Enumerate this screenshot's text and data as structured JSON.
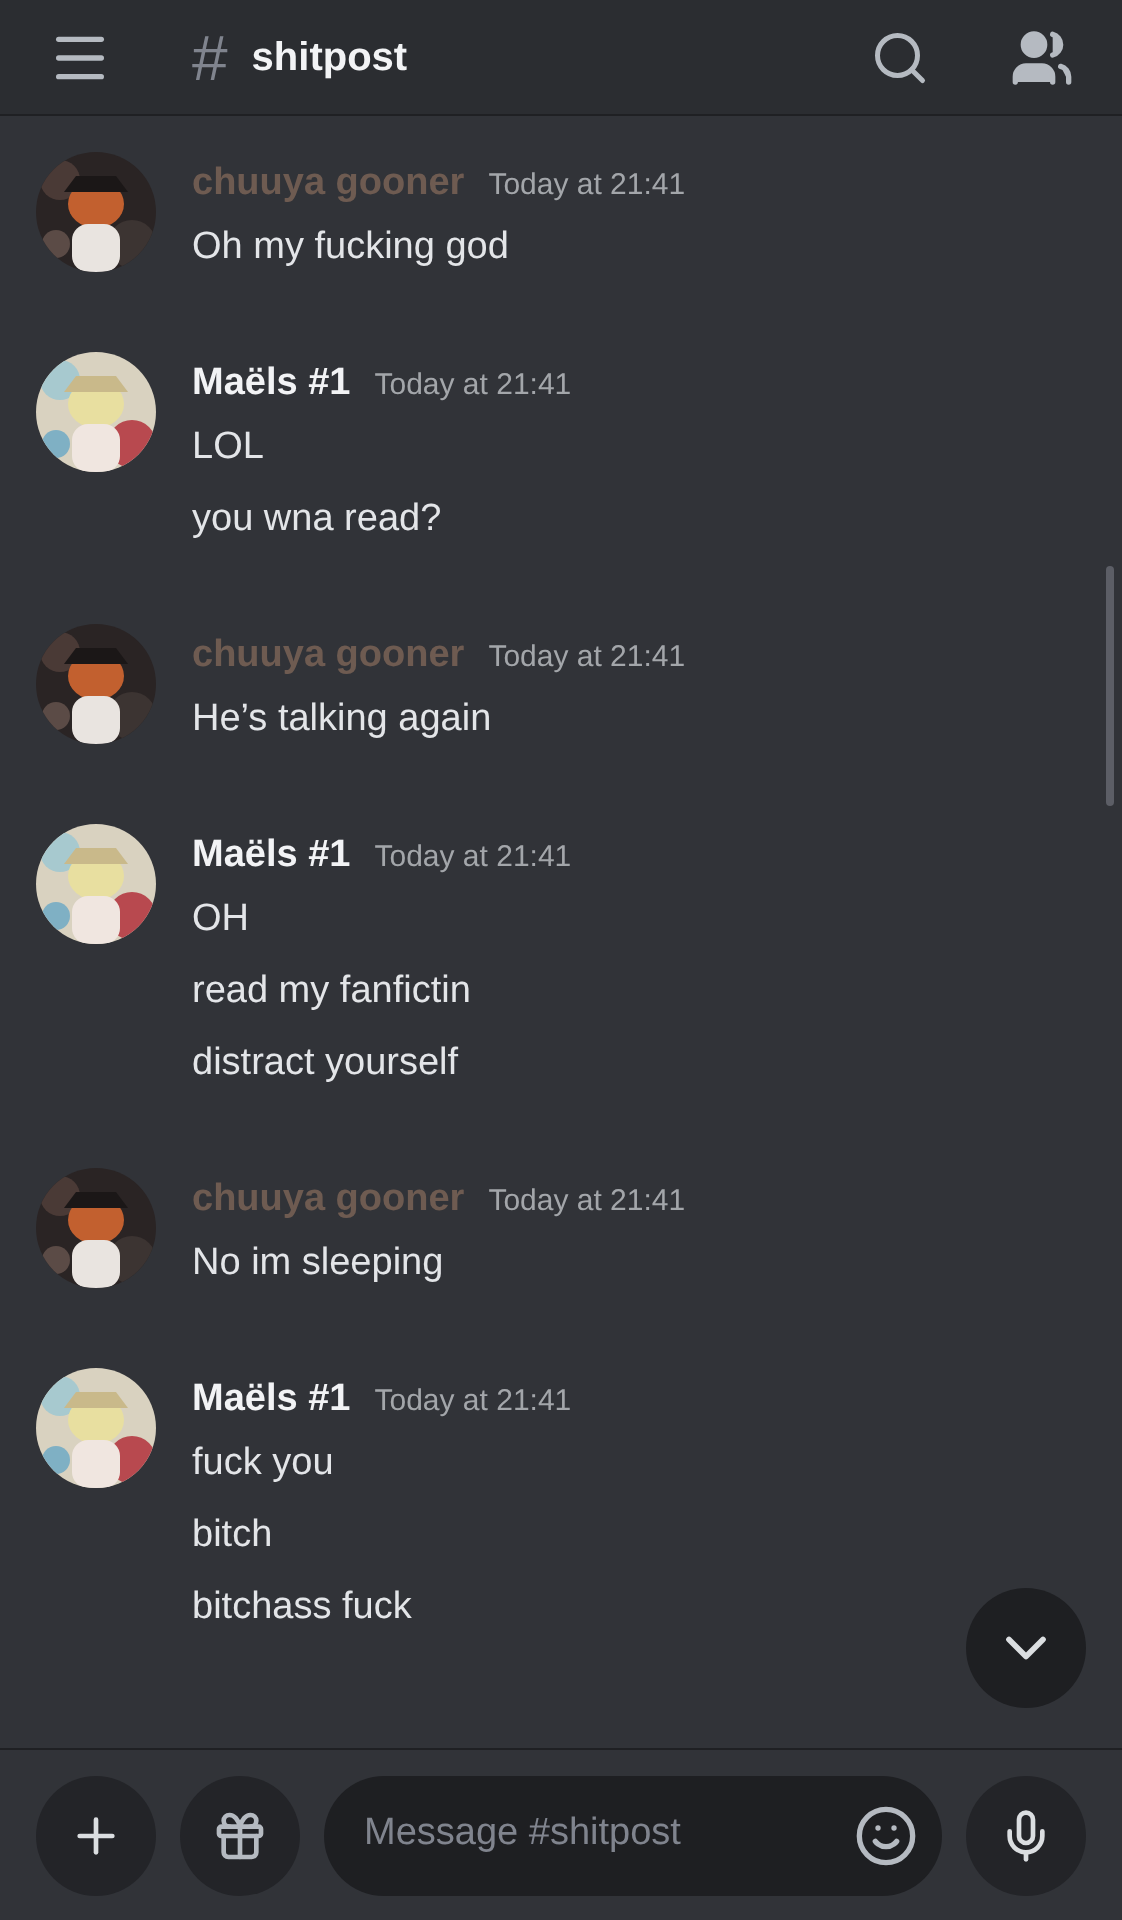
{
  "header": {
    "channel_icon": "#",
    "channel": "shitpost"
  },
  "messages": [
    {
      "author": "chuuya gooner",
      "color": "#6e5b51",
      "time": "Today at 21:41",
      "lines": [
        "Oh my fucking god"
      ]
    },
    {
      "author": "Maëls #1",
      "color": "#f2f3f5",
      "time": "Today at 21:41",
      "lines": [
        "LOL",
        "you wna read?"
      ]
    },
    {
      "author": "chuuya gooner",
      "color": "#6e5b51",
      "time": "Today at 21:41",
      "lines": [
        "He’s talking again"
      ]
    },
    {
      "author": "Maëls #1",
      "color": "#f2f3f5",
      "time": "Today at 21:41",
      "lines": [
        "OH",
        "read my fanfictin",
        "distract yourself"
      ]
    },
    {
      "author": "chuuya gooner",
      "color": "#6e5b51",
      "time": "Today at 21:41",
      "lines": [
        "No im sleeping"
      ]
    },
    {
      "author": "Maëls #1",
      "color": "#f2f3f5",
      "time": "Today at 21:41",
      "lines": [
        "fuck you",
        "bitch",
        "bitchass fuck"
      ]
    }
  ],
  "composer": {
    "placeholder": "Message #shitpost"
  }
}
